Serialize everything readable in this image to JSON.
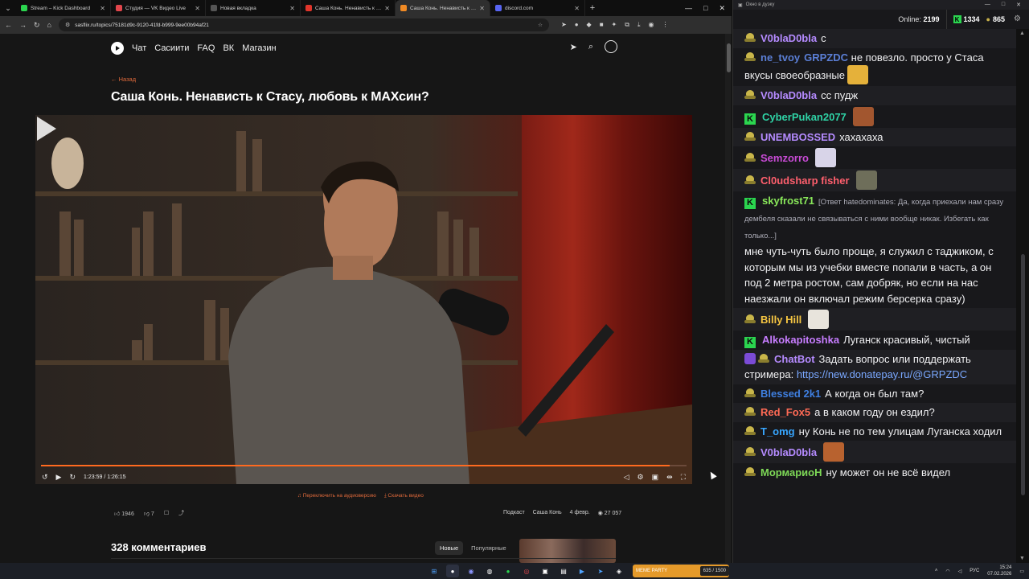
{
  "browser": {
    "tabs": [
      {
        "title": "Stream – Kick Dashboard",
        "color": "#2bd54f",
        "active": false
      },
      {
        "title": "Студия — VK Видео Live",
        "color": "#e2464c",
        "active": false
      },
      {
        "title": "Новая вкладка",
        "color": "#555555",
        "active": false
      },
      {
        "title": "Саша Конь. Ненависть к Стасу",
        "color": "#e0352b",
        "active": false
      },
      {
        "title": "Саша Конь. Ненависть к Стасу",
        "color": "#f08a24",
        "active": true
      },
      {
        "title": "discord.com",
        "color": "#5865f2",
        "active": false
      }
    ],
    "new_tab": "+",
    "url": "sasflix.ru/topics/75181d9c-9120-41fd-b999-9ee00b94af21"
  },
  "site": {
    "nav": [
      "Чат",
      "Сасиити",
      "FAQ",
      "ВК",
      "Магазин"
    ],
    "back": "← Назад",
    "title": "Саша Конь. Ненависть к Стасу, любовь к МАХсин?",
    "player": {
      "time": "1:23:59 / 1:26:15",
      "progress": 0.974
    },
    "audio_link": "Переключить на аудиоверсию",
    "download_link": "Скачать видео",
    "likes": "1946",
    "dislikes": "7",
    "tag1": "Подкаст",
    "tag2": "Саша Конь",
    "date": "4 февр.",
    "views": "27 057",
    "comments_title": "328 комментариев",
    "sort_new": "Новые",
    "sort_popular": "Популярные"
  },
  "chat": {
    "window_title": "Окно в дуэку",
    "online_label": "Online:",
    "online": "2199",
    "kick_count": "1334",
    "hat_count": "865",
    "messages": [
      {
        "badge": "hat",
        "user": "V0blaD0bla",
        "color": "#b58bff",
        "text": "c",
        "alt": true
      },
      {
        "badge": "hat",
        "user": "ne_tvoy",
        "color": "#5b7fd6",
        "text": "GRPZDC не повезло. просто у Стаса вкусы своеобразные",
        "mention": "GRPZDC",
        "emote": "#e5b13a",
        "alt": false
      },
      {
        "badge": "hat",
        "user": "V0blaD0bla",
        "color": "#b58bff",
        "text": "сс пудж",
        "alt": true
      },
      {
        "badge": "k",
        "user": "CyberPukan2077",
        "color": "#2fd3a6",
        "text": "",
        "emote": "#a2562f",
        "alt": false
      },
      {
        "badge": "hat",
        "user": "UNEMBOSSED",
        "color": "#b58bff",
        "text": "хахахаха",
        "alt": true
      },
      {
        "badge": "hat",
        "user": "Semzorro",
        "color": "#c94bd6",
        "text": "",
        "emote": "#d8d4e8",
        "alt": false
      },
      {
        "badge": "hat",
        "user": "Cl0udsharp fisher",
        "color": "#ff5f6d",
        "text": "",
        "emote": "#6e6e5a",
        "alt": true
      },
      {
        "badge": "k",
        "user": "skyfrost71",
        "color": "#89e85a",
        "reply": "[Ответ hatedominates: Да, когда приехали нам сразу дембеля сказали не связываться с ними вообще никак. Избегать как только...]",
        "text": "мне чуть-чуть было проще, я служил с таджиком, с которым мы из учебки вместе попали в часть, а он под 2 метра ростом, сам добряк, но если на нас наезжали он включал режим берсерка сразу)",
        "alt": false
      },
      {
        "badge": "hat",
        "user": "Billy Hill",
        "color": "#f5c542",
        "text": "",
        "emote": "#e8e4dc",
        "alt": true
      },
      {
        "badge": "k",
        "user": "Alkokapitoshka",
        "color": "#c77dff",
        "text": "Луганск красивый, чистый",
        "alt": false
      },
      {
        "badge": "bot",
        "user": "ChatBot",
        "color": "#b58bff",
        "text": "Задать вопрос или поддержать стримера:",
        "link": "https://new.donatepay.ru/@GRPZDC",
        "alt": true
      },
      {
        "badge": "hat",
        "user": "Blessed 2k1",
        "color": "#3f7fe0",
        "text": "А когда он был там?",
        "alt": false
      },
      {
        "badge": "hat",
        "user": "Red_Fox5",
        "color": "#ff6a55",
        "text": "а в каком году он ездил?",
        "alt": true
      },
      {
        "badge": "hat",
        "user": "T_omg",
        "color": "#37a6ff",
        "text": "ну Конь не по тем улицам Луганска ходил",
        "alt": false
      },
      {
        "badge": "hat",
        "user": "V0blaD0bla",
        "color": "#b58bff",
        "text": "",
        "emote": "#b8622f",
        "alt": true
      },
      {
        "badge": "hat",
        "user": "MормариoH",
        "color": "#7ed957",
        "text": "ну может он не всё видел",
        "alt": false
      }
    ]
  },
  "taskbar": {
    "meme_label": "MEME PARTY",
    "meme_count": "635 / 1500",
    "lang": "РУС",
    "time": "15:24",
    "date": "07.02.2026"
  }
}
